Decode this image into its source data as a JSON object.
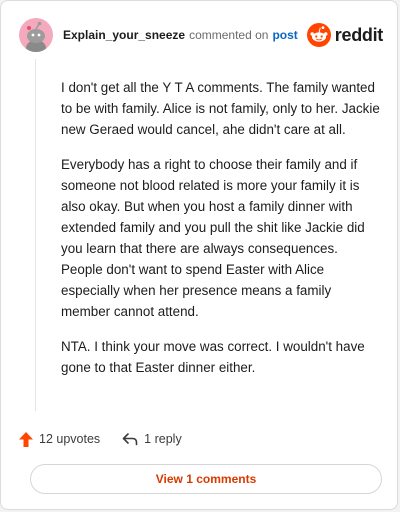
{
  "comment": {
    "username": "Explain_your_sneeze",
    "action_text": "commented on",
    "post_link": "post",
    "brand": "reddit",
    "paragraphs": [
      "I don't get all the Y T A comments. The family wanted to be with family. Alice is not family, only to her. Jackie new Geraed would cancel, ahe didn't care at all.",
      "Everybody has a right to choose their family and if someone not blood related is more your family it is also okay. But when you host a family dinner with extended family and you pull the shit like Jackie did you learn that there are always consequences. People don't want to spend Easter with Alice especially when her presence means a family member cannot attend.",
      "NTA. I think your move was correct. I wouldn't have gone to that Easter dinner either."
    ],
    "upvotes_label": "12 upvotes",
    "replies_label": "1 reply",
    "view_comments_label": "View 1 comments"
  },
  "icons": {
    "avatar": "snoo-avatar-icon",
    "brand": "reddit-logo-icon",
    "upvote": "upvote-arrow-icon",
    "reply": "reply-arrow-icon"
  },
  "colors": {
    "accent": "#ff4500",
    "link": "#0a66c2",
    "button_text": "#d93a00",
    "avatar_bg": "#f4a9bd"
  }
}
